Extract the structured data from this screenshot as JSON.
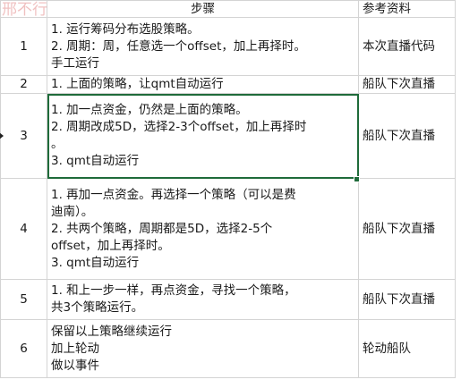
{
  "watermark": {
    "text": "邢不行"
  },
  "header": {
    "num": "",
    "steps": "步骤",
    "ref": "参考资料"
  },
  "rows": [
    {
      "num": "1",
      "lines": [
        "1. 运行筹码分布选股策略。",
        "2. 周期：周，任意选一个offset，加上再择时。",
        "手工运行"
      ],
      "ref": "本次直播代码"
    },
    {
      "num": "2",
      "lines": [
        "1. 上面的策略，让qmt自动运行"
      ],
      "ref": "船队下次直播"
    },
    {
      "num": "3",
      "lines": [
        "1. 加一点资金，仍然是上面的策略。",
        "2. 周期改成5D，选择2-3个offset，加上再择时",
        "。",
        "3. qmt自动运行"
      ],
      "ref": "船队下次直播"
    },
    {
      "num": "4",
      "lines": [
        "1. 再加一点资金。再选择一个策略（可以是费",
        "迪南）。",
        "2. 共两个策略，周期都是5D，选择2-5个",
        "offset，加上再择时。",
        "3. qmt自动运行"
      ],
      "ref": "船队下次直播"
    },
    {
      "num": "5",
      "lines": [
        "1. 和上一步一样，再点资金，寻找一个策略，",
        "共3个策略运行。"
      ],
      "ref": "船队下次直播"
    },
    {
      "num": "6",
      "lines": [
        "保留以上策略继续运行",
        "加上轮动",
        "做以事件"
      ],
      "ref": "轮动船队"
    }
  ]
}
